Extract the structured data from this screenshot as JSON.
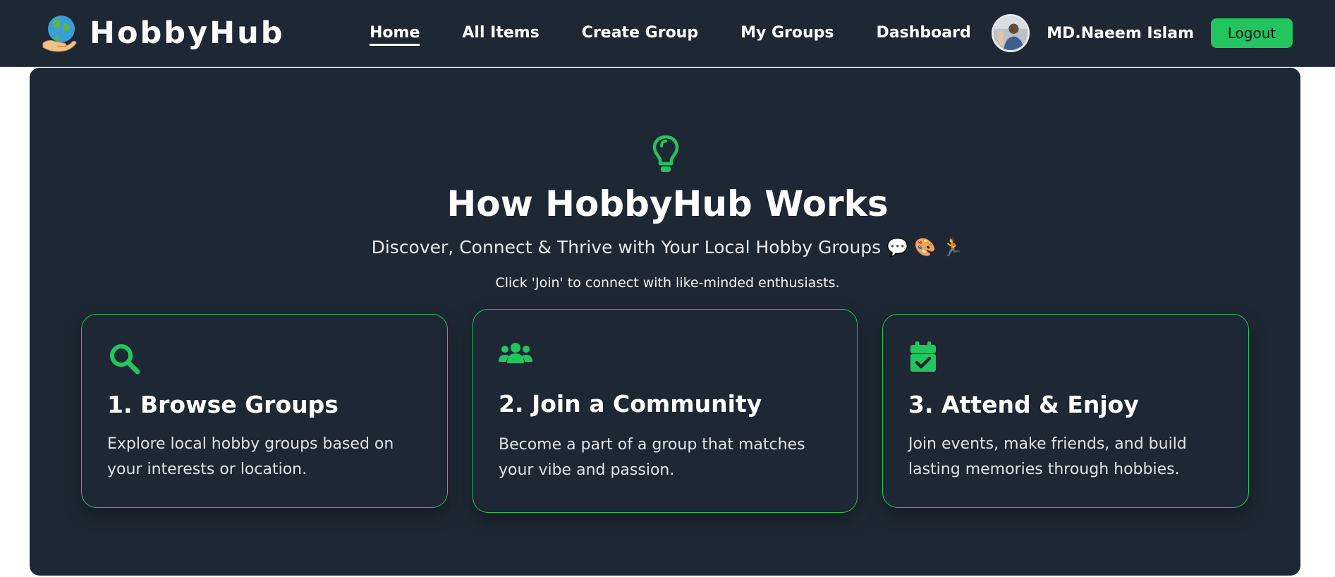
{
  "brand": {
    "name": "HobbyHub",
    "logo_icon": "globe-hand-icon"
  },
  "nav": {
    "links": [
      {
        "label": "Home",
        "active": true
      },
      {
        "label": "All Items",
        "active": false
      },
      {
        "label": "Create Group",
        "active": false
      },
      {
        "label": "My Groups",
        "active": false
      },
      {
        "label": "Dashboard",
        "active": false
      }
    ]
  },
  "user": {
    "name": "MD.Naeem Islam",
    "logout_label": "Logout"
  },
  "colors": {
    "accent": "#22c55e",
    "background": "#1e2834",
    "text": "#ffffff"
  },
  "section": {
    "icon": "lightbulb-icon",
    "title": "How HobbyHub Works",
    "subtitle": "Discover, Connect & Thrive with Your Local Hobby Groups 💬 🎨 🏃",
    "note": "Click 'Join' to connect with like-minded enthusiasts."
  },
  "cards": [
    {
      "icon": "search-icon",
      "title": "1. Browse Groups",
      "text": "Explore local hobby groups based on your interests or location."
    },
    {
      "icon": "users-icon",
      "title": "2. Join a Community",
      "text": "Become a part of a group that matches your vibe and passion."
    },
    {
      "icon": "calendar-check-icon",
      "title": "3. Attend & Enjoy",
      "text": "Join events, make friends, and build lasting memories through hobbies."
    }
  ]
}
